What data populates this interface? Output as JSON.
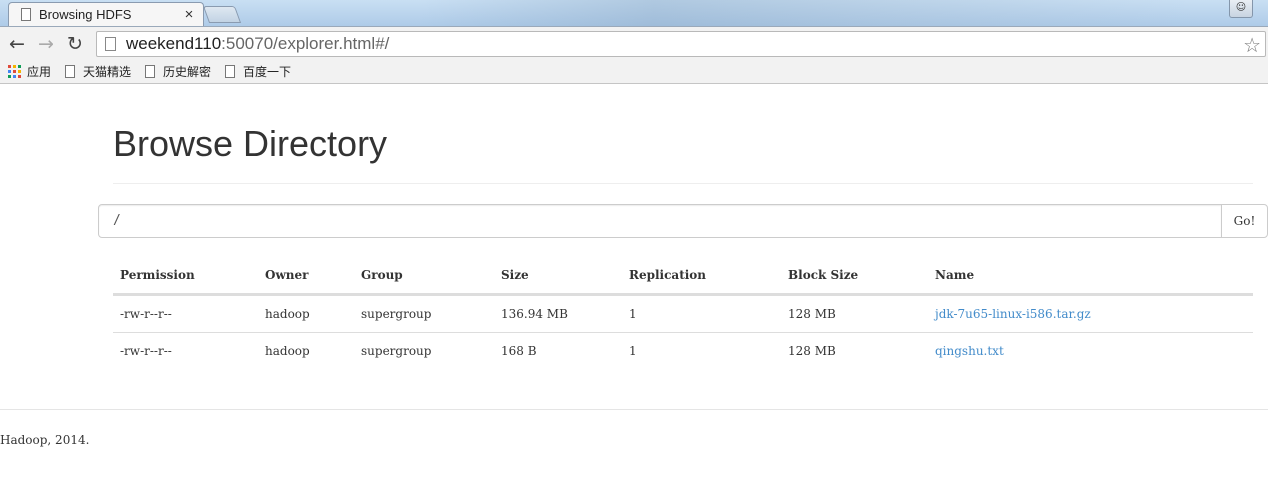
{
  "browser": {
    "tab": {
      "title": "Browsing HDFS",
      "close_label": "×"
    },
    "address": {
      "host": "weekend110",
      "rest": ":50070/explorer.html#/"
    },
    "nav": {
      "back": "←",
      "forward": "→",
      "reload": "↻",
      "star": "☆"
    },
    "bookmarks": [
      {
        "label": "应用"
      },
      {
        "label": "天猫精选"
      },
      {
        "label": "历史解密"
      },
      {
        "label": "百度一下"
      }
    ],
    "apps_colors": [
      "#e04a3a",
      "#f4b400",
      "#0f9d58",
      "#4285f4",
      "#e04a3a",
      "#f4b400",
      "#0f9d58",
      "#4285f4",
      "#e04a3a"
    ]
  },
  "page": {
    "title": "Browse Directory",
    "path_input": "/",
    "go_label": "Go!",
    "table": {
      "headers": [
        "Permission",
        "Owner",
        "Group",
        "Size",
        "Replication",
        "Block Size",
        "Name"
      ],
      "rows": [
        {
          "permission": "-rw-r--r--",
          "owner": "hadoop",
          "group": "supergroup",
          "size": "136.94 MB",
          "replication": "1",
          "block_size": "128 MB",
          "name": "jdk-7u65-linux-i586.tar.gz"
        },
        {
          "permission": "-rw-r--r--",
          "owner": "hadoop",
          "group": "supergroup",
          "size": "168 B",
          "replication": "1",
          "block_size": "128 MB",
          "name": "qingshu.txt"
        }
      ]
    },
    "footer": "Hadoop, 2014.",
    "link_color": "#428bca"
  }
}
